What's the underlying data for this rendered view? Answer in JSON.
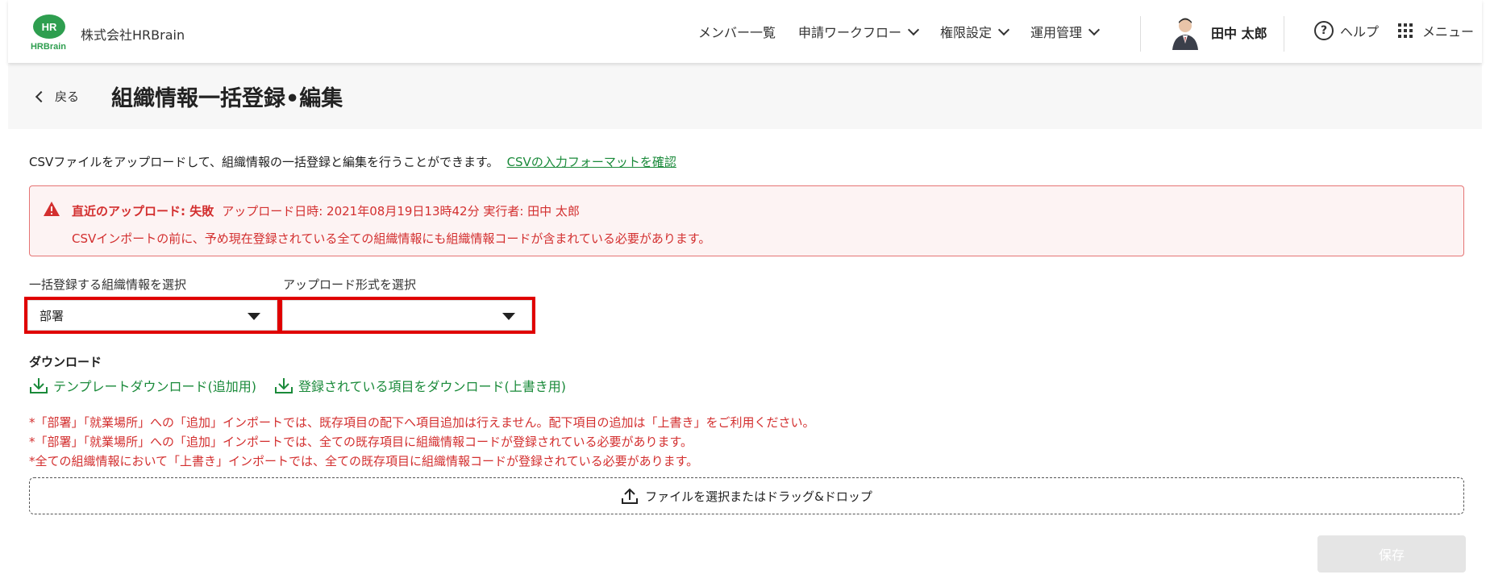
{
  "header": {
    "logo_text": "HR",
    "logo_brand": "HRBrain",
    "company": "株式会社HRBrain",
    "nav": [
      {
        "label": "メンバー一覧",
        "dropdown": false
      },
      {
        "label": "申請ワークフロー",
        "dropdown": true
      },
      {
        "label": "権限設定",
        "dropdown": true
      },
      {
        "label": "運用管理",
        "dropdown": true
      }
    ],
    "user_name": "田中 太郎",
    "help_label": "ヘルプ",
    "menu_label": "メニュー"
  },
  "titlebar": {
    "back_label": "戻る",
    "title": "組織情報一括登録•編集"
  },
  "description": {
    "text": "CSVファイルをアップロードして、組織情報の一括登録と編集を行うことができます。",
    "link": "CSVの入力フォーマットを確認"
  },
  "alert": {
    "status": "直近のアップロード: 失敗",
    "meta": "アップロード日時: 2021年08月19日13時42分   実行者: 田中 太郎",
    "message": "CSVインポートの前に、予め現在登録されている全ての組織情報にも組織情報コードが含まれている必要があります。"
  },
  "selects": {
    "org_label": "一括登録する組織情報を選択",
    "org_value": "部署",
    "format_label": "アップロード形式を選択",
    "format_value": ""
  },
  "download": {
    "title": "ダウンロード",
    "template_link": "テンプレートダウンロード(追加用)",
    "registered_link": "登録されている項目をダウンロード(上書き用)"
  },
  "notes": [
    "*「部署」「就業場所」への「追加」インポートでは、既存項目の配下へ項目追加は行えません。配下項目の追加は「上書き」をご利用ください。",
    "*「部署」「就業場所」への「追加」インポートでは、全ての既存項目に組織情報コードが登録されている必要があります。",
    "*全ての組織情報において「上書き」インポートでは、全ての既存項目に組織情報コードが登録されている必要があります。"
  ],
  "dropzone_label": "ファイルを選択またはドラッグ&ドロップ",
  "save_label": "保存",
  "colors": {
    "brand_green": "#1a8a3a",
    "error_red": "#d32f2f",
    "highlight_red": "#e00000"
  }
}
